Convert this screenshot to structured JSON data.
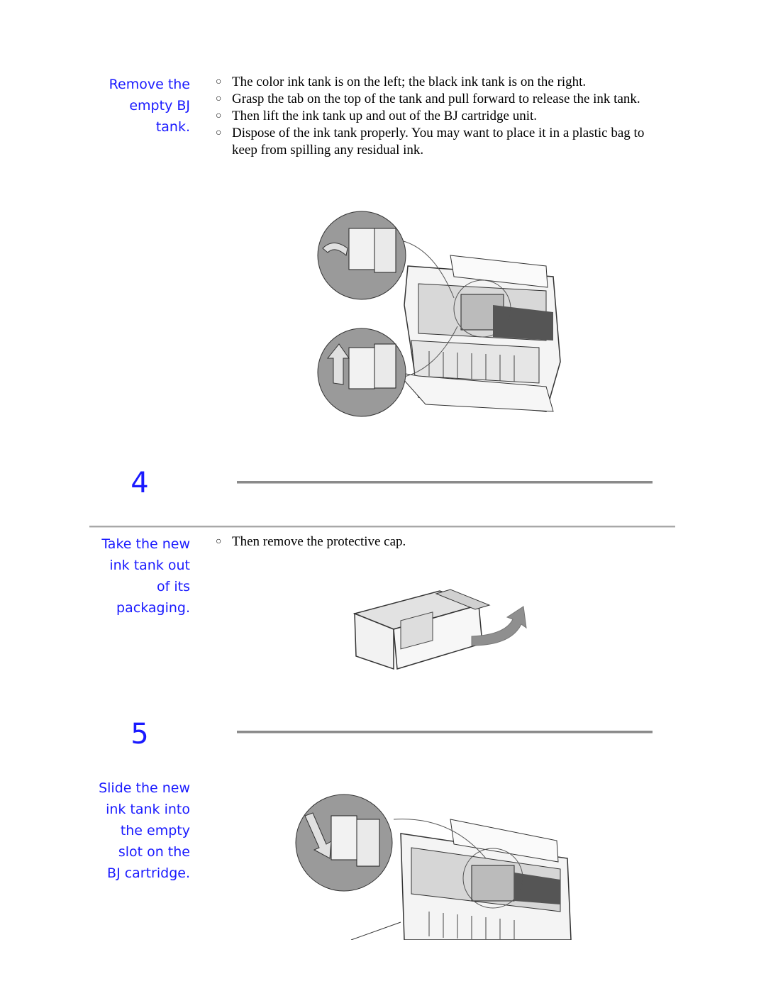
{
  "section_remove": {
    "heading_lines": [
      "Remove the",
      "empty BJ",
      "tank."
    ],
    "bullets": [
      "The color ink tank is on the left; the black ink tank is on the right.",
      "Grasp the tab on the top of the tank and pull forward to release the ink tank.",
      "Then lift the ink tank up and out of the BJ cartridge unit.",
      "Dispose of the ink tank properly. You may want to place it in a plastic bag to keep from spilling any residual ink."
    ],
    "illustration": "printer-remove-ink-tank-illustration"
  },
  "step4": {
    "number": "4",
    "heading_lines": [
      "Take the new",
      "ink tank out",
      "of its",
      "packaging."
    ],
    "bullets": [
      "Then remove the protective cap."
    ],
    "illustration": "ink-tank-cap-removal-illustration"
  },
  "step5": {
    "number": "5",
    "heading_lines": [
      "Slide the new",
      "ink tank into",
      "the empty",
      "slot on the",
      "BJ cartridge."
    ],
    "illustration": "printer-insert-ink-tank-illustration"
  },
  "bullet_glyph": "○",
  "colors": {
    "heading": "#1a1aff",
    "rule": "#8a8a8a"
  }
}
